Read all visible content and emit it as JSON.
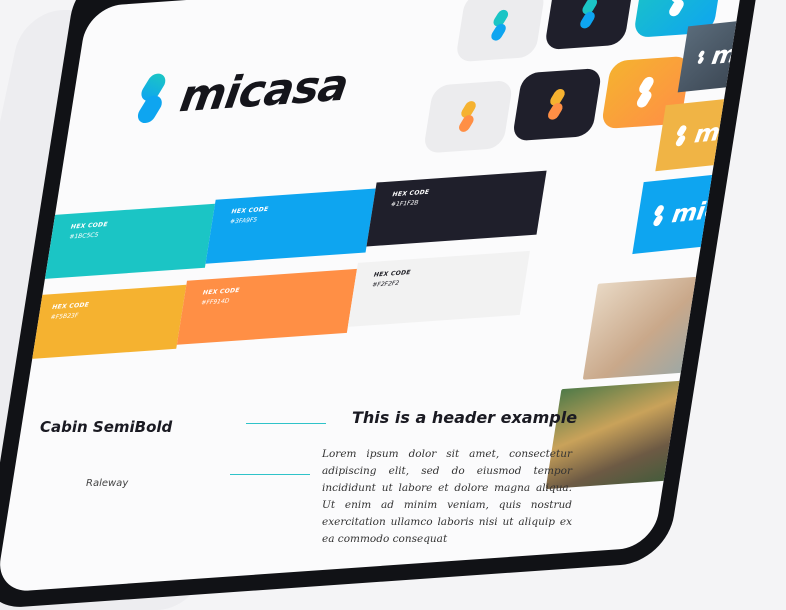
{
  "brand": {
    "name": "micasa"
  },
  "colors": {
    "cyan": "#1BC5C5",
    "blue": "#0EA5F0",
    "dark": "#1F1F2B",
    "yellow": "#F5B230",
    "orange": "#FF8F45",
    "light": "#F2F2F2"
  },
  "app_icons": [
    {
      "bg": "#ececee",
      "variant": "blue"
    },
    {
      "bg": "#1f1f2b",
      "variant": "blue"
    },
    {
      "bg": "#1ac3d2",
      "variant": "white"
    },
    {
      "bg": "#ececee",
      "variant": "orange"
    },
    {
      "bg": "#1f1f2b",
      "variant": "orange"
    },
    {
      "bg": "#ff9a3d",
      "variant": "white"
    }
  ],
  "swatches": [
    {
      "label": "HEX CODE",
      "value": "#1BC5C5"
    },
    {
      "label": "HEX CODE",
      "value": "#3FA9F5"
    },
    {
      "label": "HEX CODE",
      "value": "#1F1F2B"
    },
    {
      "label": "HEX CODE",
      "value": "#F5B23F"
    },
    {
      "label": "HEX CODE",
      "value": "#FF914D"
    },
    {
      "label": "HEX CODE",
      "value": "#F2F2F2"
    }
  ],
  "typography": {
    "primary_font": "Cabin SemiBold",
    "secondary_font": "Raleway",
    "header_example": "This is a header example",
    "body_example": "Lorem ipsum dolor sit amet, consectetur adipiscing elit, sed do eiusmod tempor incididunt ut labore et dolore magna aliqua. Ut enim ad minim veniam, quis nostrud exercitation ullamco laboris nisi ut aliquip ex ea commodo consequat"
  },
  "banners": [
    {
      "text": "micasa"
    },
    {
      "text": "micasa"
    },
    {
      "text": "micasa"
    }
  ]
}
